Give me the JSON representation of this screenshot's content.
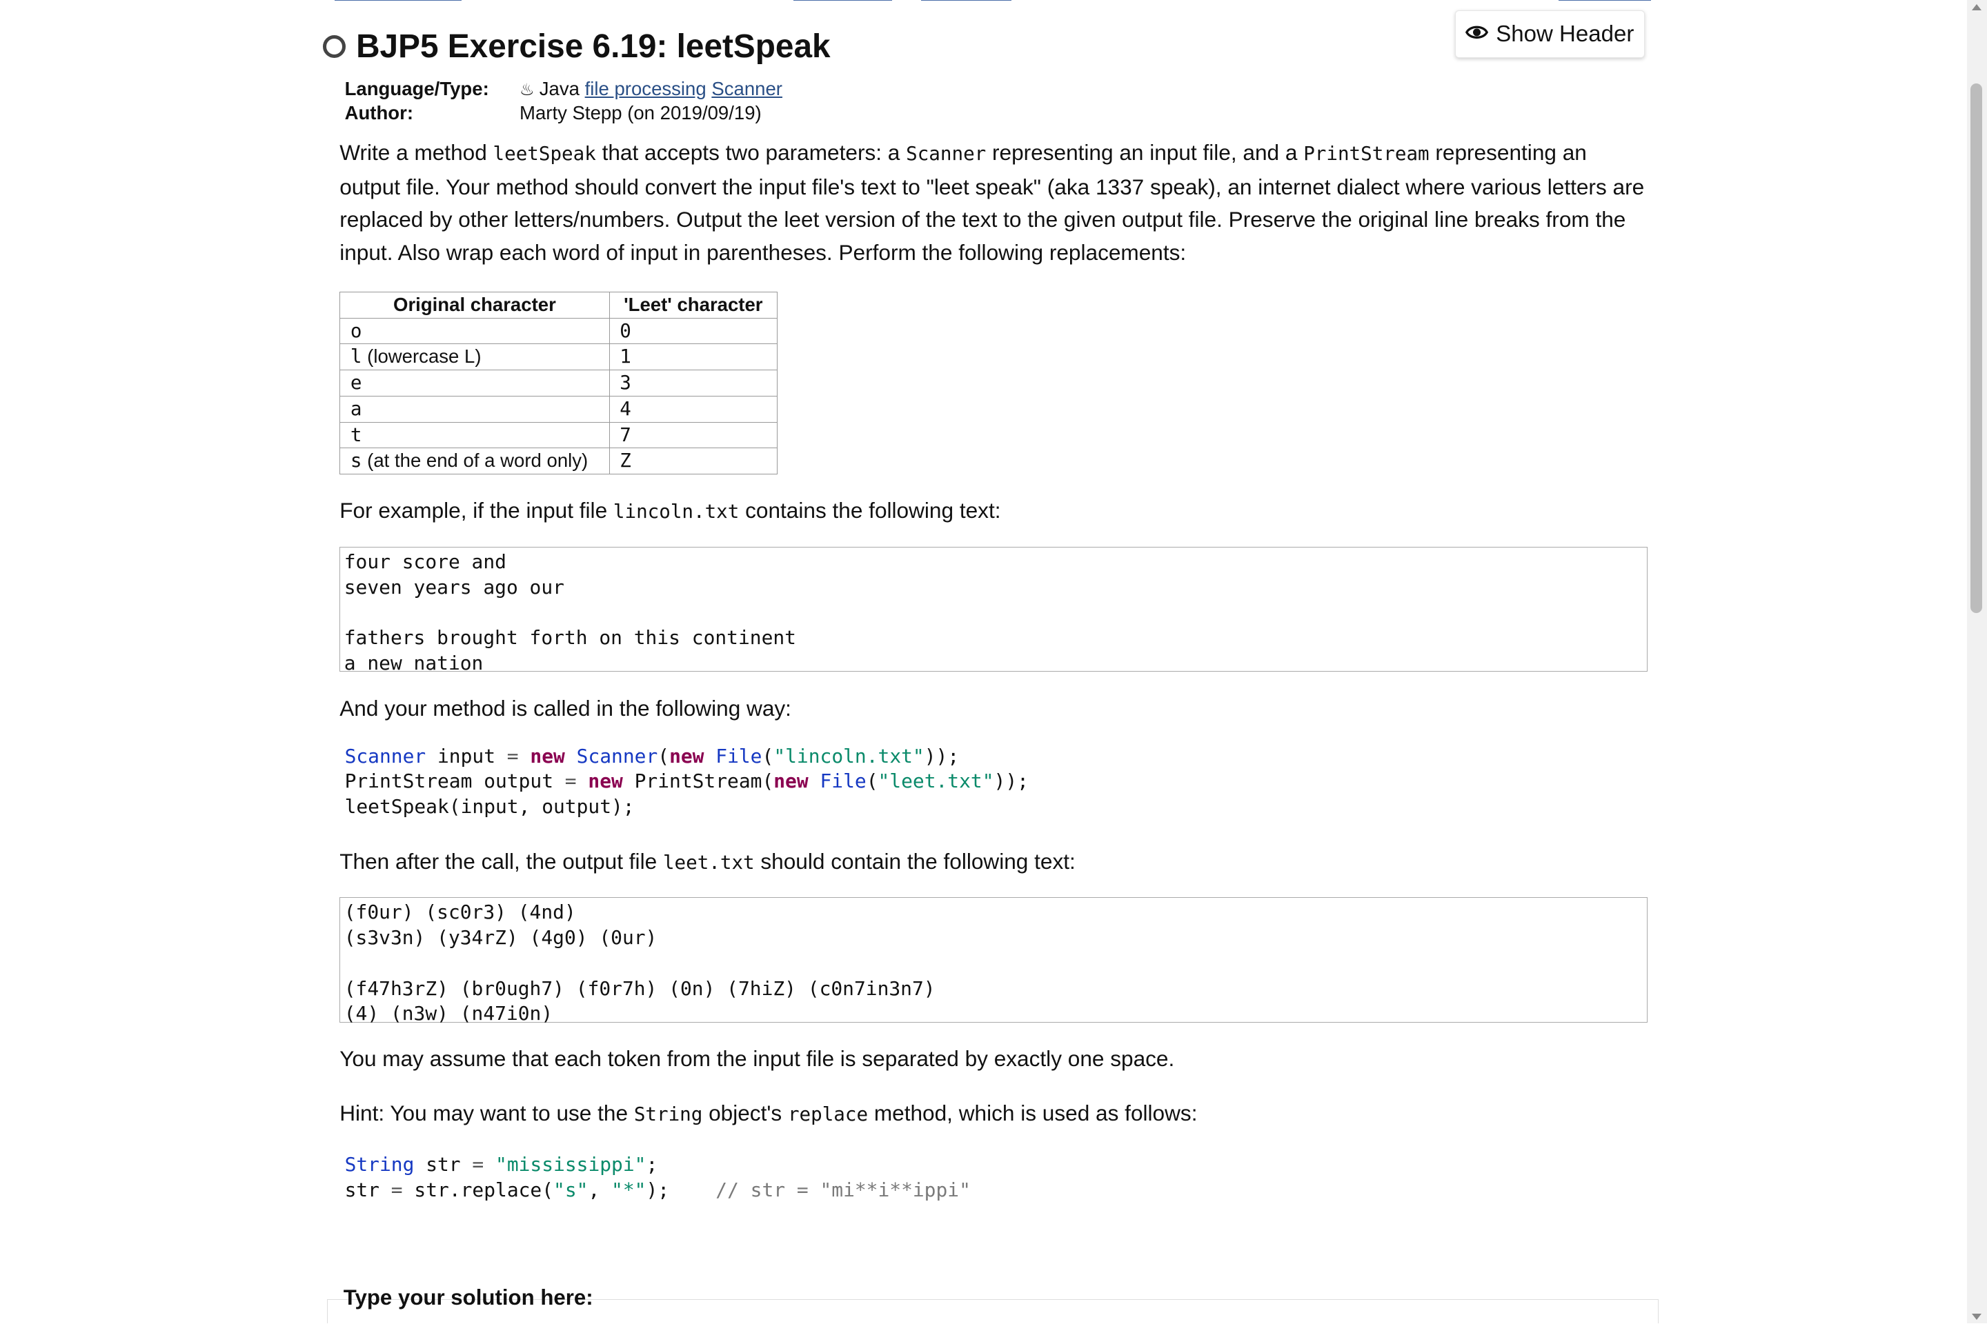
{
  "header": {
    "show_header_label": "Show Header",
    "title": "BJP5 Exercise 6.19: leetSpeak"
  },
  "meta": {
    "language_key": "Language/Type:",
    "language_value": "Java",
    "tag1": "file processing",
    "tag2": "Scanner",
    "author_key": "Author:",
    "author_value": "Marty Stepp (on 2019/09/19)"
  },
  "intro": {
    "p1_a": "Write a method ",
    "p1_code1": "leetSpeak",
    "p1_b": " that accepts two parameters: a ",
    "p1_code2": "Scanner",
    "p1_c": " representing an input file, and a ",
    "p1_code3": "PrintStream",
    "p1_d": " representing an output file. Your method should convert the input file's text to \"leet speak\" (aka 1337 speak), an internet dialect where various letters are replaced by other letters/numbers. Output the leet version of the text to the given output file. Preserve the original line breaks from the input. Also wrap each word of input in parentheses. Perform the following replacements:"
  },
  "table": {
    "headers": [
      "Original character",
      "'Leet' character"
    ],
    "rows": [
      {
        "orig_code": "o",
        "orig_note": "",
        "leet": "0"
      },
      {
        "orig_code": "l",
        "orig_note": " (lowercase L)",
        "leet": "1"
      },
      {
        "orig_code": "e",
        "orig_note": "",
        "leet": "3"
      },
      {
        "orig_code": "a",
        "orig_note": "",
        "leet": "4"
      },
      {
        "orig_code": "t",
        "orig_note": "",
        "leet": "7"
      },
      {
        "orig_code": "s",
        "orig_note": " (at the end of a word only)",
        "leet": "Z"
      }
    ]
  },
  "example": {
    "p_a": "For example, if the input file ",
    "p_code": "lincoln.txt",
    "p_b": " contains the following text:",
    "input_lines": [
      "four score and",
      "seven years ago our",
      "",
      "fathers brought forth on this continent",
      "a new nation"
    ],
    "called_text": "And your method is called in the following way:",
    "code_lines": [
      "Scanner input = new Scanner(new File(\"lincoln.txt\"));",
      "PrintStream output = new PrintStream(new File(\"leet.txt\"));",
      "leetSpeak(input, output);"
    ],
    "after_a": "Then after the call, the output file ",
    "after_code": "leet.txt",
    "after_b": " should contain the following text:",
    "output_lines": [
      "(f0ur) (sc0r3) (4nd)",
      "(s3v3n) (y34rZ) (4g0) (0ur)",
      "",
      "(f47h3rZ) (br0ugh7) (f0r7h) (0n) (7hiZ) (c0n7in3n7)",
      "(4) (n3w) (n47i0n)"
    ],
    "assume_text": "You may assume that each token from the input file is separated by exactly one space.",
    "hint_a": "Hint: You may want to use the ",
    "hint_code1": "String",
    "hint_b": " object's ",
    "hint_code2": "replace",
    "hint_c": " method, which is used as follows:",
    "hint_code_lines": [
      "String str = \"mississippi\";",
      "str = str.replace(\"s\", \"*\");    // str = \"mi**i**ippi\""
    ]
  },
  "solution": {
    "label": "Type your solution here:"
  }
}
